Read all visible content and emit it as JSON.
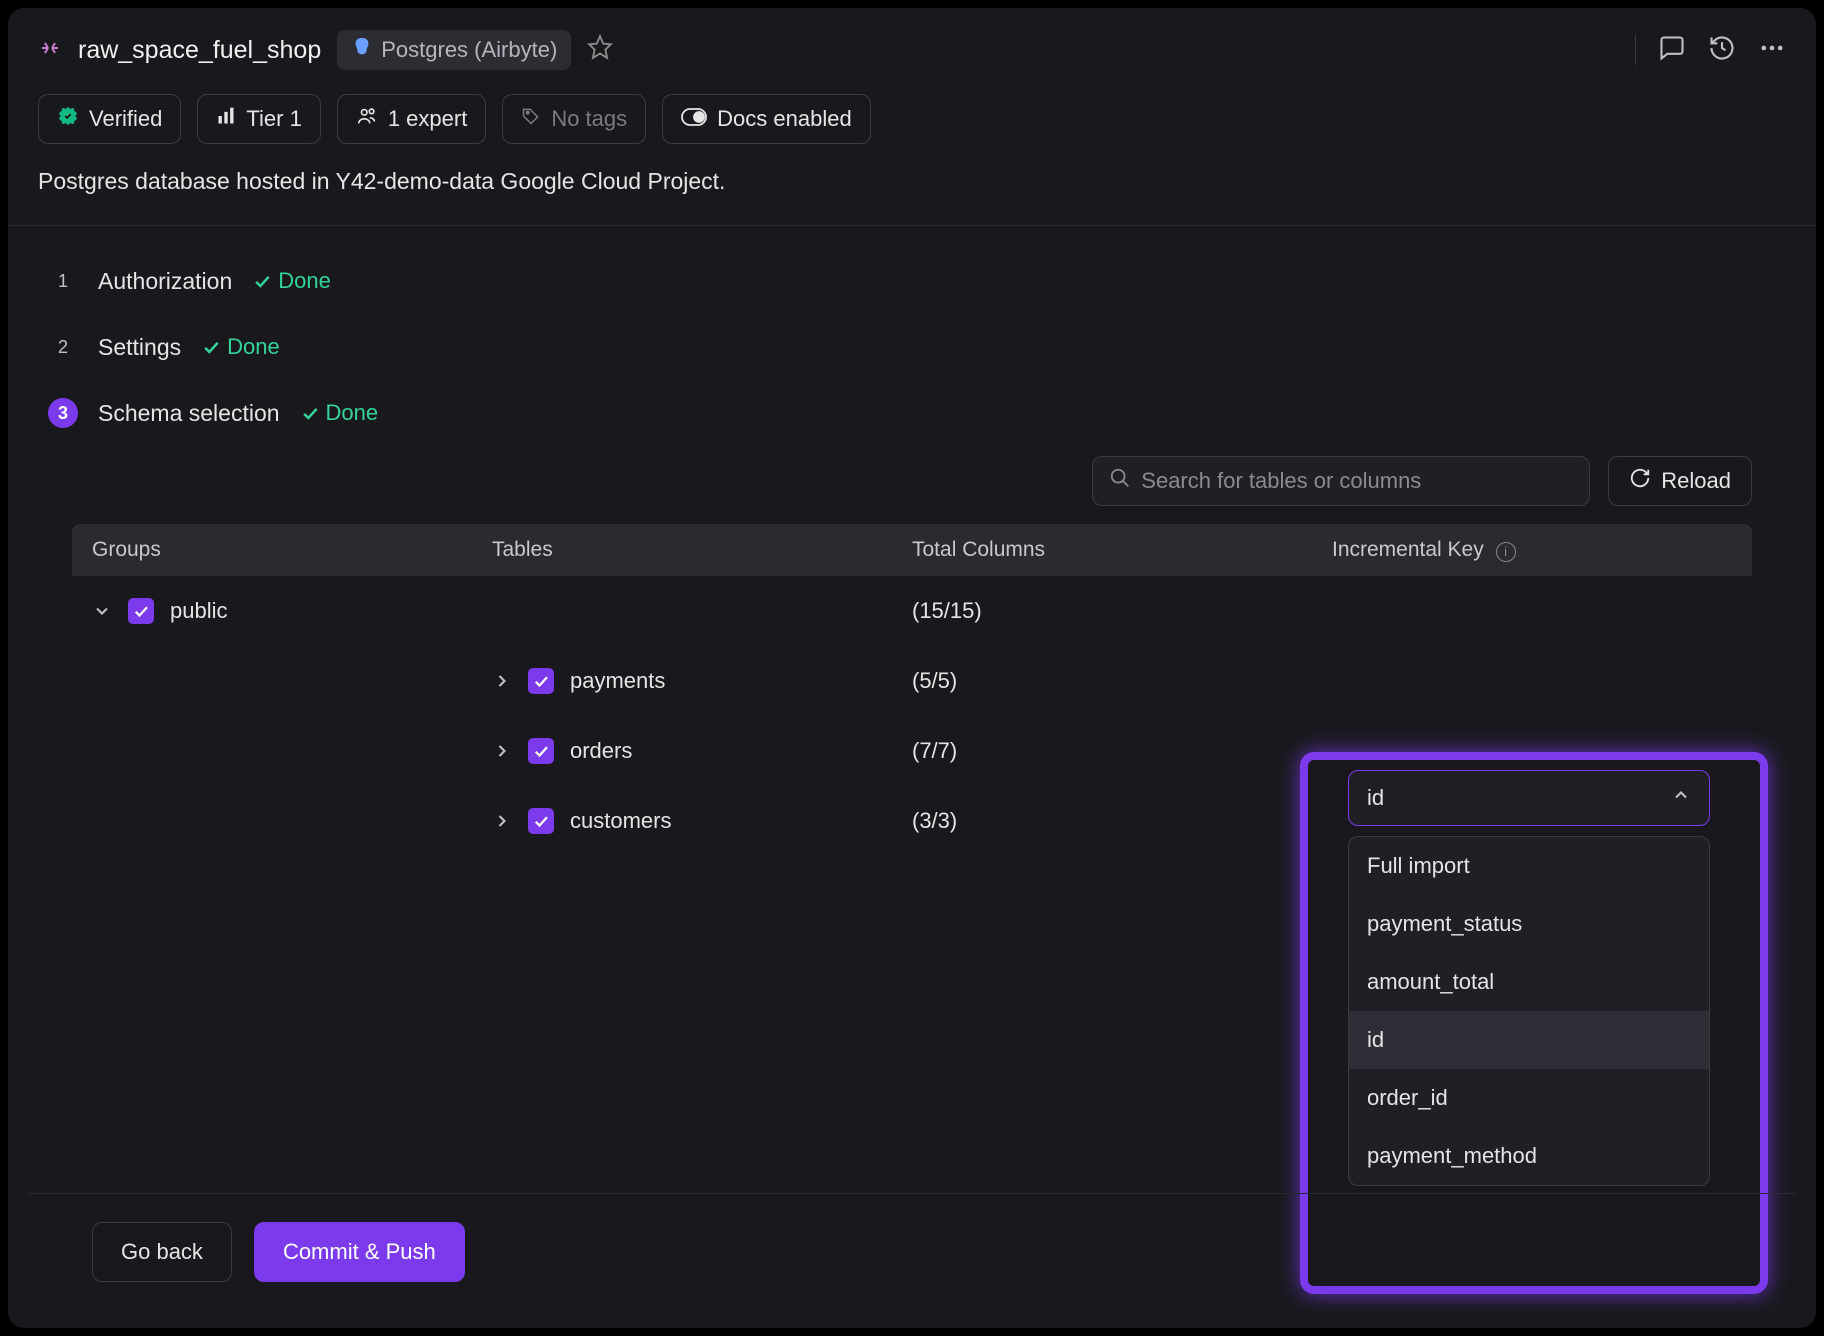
{
  "header": {
    "title": "raw_space_fuel_shop",
    "source_chip": "Postgres (Airbyte)"
  },
  "badges": {
    "verified": "Verified",
    "tier": "Tier 1",
    "expert": "1 expert",
    "notags": "No tags",
    "docs": "Docs enabled"
  },
  "description": "Postgres database hosted in Y42-demo-data Google Cloud Project.",
  "steps": [
    {
      "num": "1",
      "label": "Authorization",
      "status": "Done",
      "active": false
    },
    {
      "num": "2",
      "label": "Settings",
      "status": "Done",
      "active": false
    },
    {
      "num": "3",
      "label": "Schema selection",
      "status": "Done",
      "active": true
    }
  ],
  "search_placeholder": "Search for tables or columns",
  "reload_label": "Reload",
  "table_headers": {
    "groups": "Groups",
    "tables": "Tables",
    "total": "Total Columns",
    "inc_key": "Incremental Key"
  },
  "group": {
    "name": "public",
    "totals": "(15/15)"
  },
  "tables": [
    {
      "name": "payments",
      "totals": "(5/5)"
    },
    {
      "name": "orders",
      "totals": "(7/7)"
    },
    {
      "name": "customers",
      "totals": "(3/3)"
    }
  ],
  "dropdown": {
    "selected": "id",
    "options": [
      "Full import",
      "payment_status",
      "amount_total",
      "id",
      "order_id",
      "payment_method"
    ],
    "highlighted": "id"
  },
  "footer": {
    "back": "Go back",
    "commit": "Commit & Push"
  }
}
